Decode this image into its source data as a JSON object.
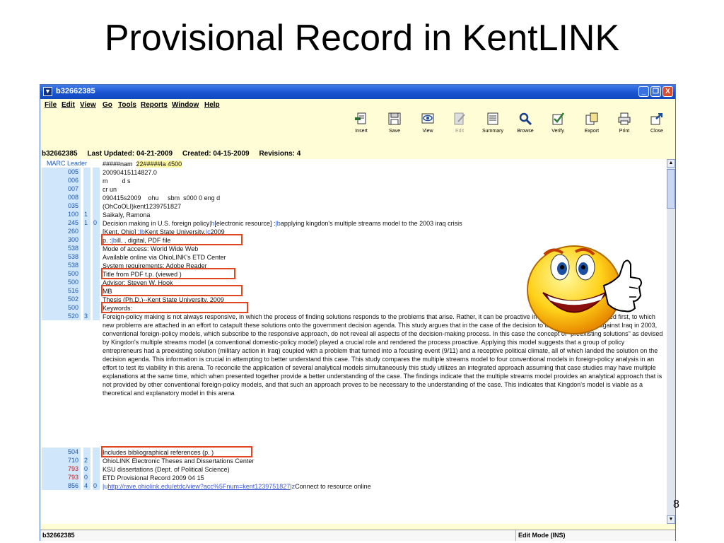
{
  "slide": {
    "title": "Provisional Record in KentLINK",
    "page_number": "8"
  },
  "window": {
    "title": "b32662385",
    "buttons": {
      "minimize": "_",
      "restore": "❐",
      "close": "X"
    }
  },
  "menu": [
    "File",
    "Edit",
    "View",
    "Go",
    "Tools",
    "Reports",
    "Window",
    "Help"
  ],
  "toolbar": {
    "insert": "Insert",
    "save": "Save",
    "view": "View",
    "edit": "Edit",
    "summary": "Summary",
    "browse": "Browse",
    "verify": "Verify",
    "export": "Export",
    "print": "Print",
    "close": "Close"
  },
  "info": {
    "record_id": "b32662385",
    "last_updated": "Last Updated: 04-21-2009",
    "created": "Created: 04-15-2009",
    "revisions": "Revisions: 4"
  },
  "records": {
    "leader": {
      "label": "MARC Leader",
      "a": "#####nam  ",
      "b": "22#####la",
      "c": " 4500"
    },
    "r005": {
      "tag": "005",
      "i1": "",
      "i2": "",
      "text": "20090415114827.0"
    },
    "r006": {
      "tag": "006",
      "i1": "",
      "i2": "",
      "text": "m        d s"
    },
    "r007": {
      "tag": "007",
      "i1": "",
      "i2": "",
      "text": "cr un"
    },
    "r008": {
      "tag": "008",
      "i1": "",
      "i2": "",
      "text": "090415s2009    ohu     sbm  s000 0 eng d"
    },
    "r035": {
      "tag": "035",
      "i1": "",
      "i2": "",
      "text": "(OhCoOLI)kent1239751827"
    },
    "r100": {
      "tag": "100",
      "i1": "1",
      "i2": "",
      "text": "Saikaly, Ramona"
    },
    "r245": {
      "tag": "245",
      "i1": "1",
      "i2": "0",
      "a": "Decision making in U.S. foreign policy",
      "sf_h": "|h",
      "b": "[electronic resource] :",
      "sf_b": "|b",
      "c": "applying kingdon's multiple streams model to the 2003 iraq crisis"
    },
    "r260": {
      "tag": "260",
      "i1": "",
      "i2": "",
      "a": "[Kent, Ohio] :",
      "sf_b": "|b",
      "b": "Kent State University,",
      "sf_c": "|c",
      "c": "2009"
    },
    "r300": {
      "tag": "300",
      "i1": "",
      "i2": "",
      "a": "p. :",
      "sf_b": "|b",
      "b": "ill. , digital, PDF file"
    },
    "r538a": {
      "tag": "538",
      "i1": "",
      "i2": "",
      "text": "Mode of access: World Wide Web"
    },
    "r538b": {
      "tag": "538",
      "i1": "",
      "i2": "",
      "text": "Available online via OhioLINK's ETD Center"
    },
    "r538c": {
      "tag": "538",
      "i1": "",
      "i2": "",
      "text": "System requirements: Adobe Reader"
    },
    "r500a": {
      "tag": "500",
      "i1": "",
      "i2": "",
      "text": "Title from PDF t.p. (viewed  )"
    },
    "r500b": {
      "tag": "500",
      "i1": "",
      "i2": "",
      "text": "Advisor: Steven W. Hook"
    },
    "r516": {
      "tag": "516",
      "i1": "",
      "i2": "",
      "text": "MB"
    },
    "r502": {
      "tag": "502",
      "i1": "",
      "i2": "",
      "text": "Thesis (Ph.D.)--Kent State University, 2009"
    },
    "r500c": {
      "tag": "500",
      "i1": "",
      "i2": "",
      "text": "Keywords:"
    },
    "r520": {
      "tag": "520",
      "i1": "3",
      "i2": "",
      "text": "Foreign-policy making is not always responsive, in which the process of finding solutions responds to the problems that arise. Rather, it can be proactive in which solutions are devised first, to which new problems are attached in an effort to catapult these solutions onto the government decision agenda. This study argues that in the case of the decision to take military action against Iraq in 2003, conventional foreign-policy models, which subscribe to the responsive approach, do not reveal all aspects of the decision-making process. In this case the concept of \"preexisting solutions\" as devised by Kingdon's multiple streams model (a conventional domestic-policy model) played a crucial role and rendered the process proactive. Applying this model suggests that a group of policy entrepreneurs had a preexisting solution (military action in Iraq) coupled with a problem that turned into a focusing event (9/11) and a receptive political climate, all of which landed the solution on the decision agenda. This information is crucial in attempting to better understand this case.  This study compares the multiple streams model to four conventional models in foreign-policy analysis in an effort to test its viability in this arena. To reconcile the application of several analytical models simultaneously this study utilizes an integrated approach assuming that case studies may have multiple explanations at the same time, which when presented together provide a better understanding of the case. The findings indicate that the multiple streams model provides an analytical approach that is not provided by other conventional foreign-policy models, and that such an approach proves to be necessary to the understanding of the case. This indicates that Kingdon's model is viable as a theoretical and explanatory model in this arena"
    },
    "r504": {
      "tag": "504",
      "i1": "",
      "i2": "",
      "text": "Includes bibliographical references (p.  )"
    },
    "r710": {
      "tag": "710",
      "i1": "2",
      "i2": "",
      "text": "OhioLINK Electronic Theses and Dissertations Center"
    },
    "r793a": {
      "tag": "793",
      "i1": "0",
      "i2": "",
      "text": "KSU dissertations (Dept. of Political Science)"
    },
    "r793b": {
      "tag": "793",
      "i1": "0",
      "i2": "",
      "text": "ETD Provisional Record 2009 04 15"
    },
    "r856": {
      "tag": "856",
      "i1": "4",
      "i2": "0",
      "sf_u": "|u",
      "url": "http://rave.ohiolink.edu/etdc/view?acc%5Fnum=kent1239751827",
      "sf_z": "|z",
      "z": "Connect to resource online"
    }
  },
  "status": {
    "record_id": "b32662385",
    "mode": "Edit Mode (INS)"
  },
  "colors": {
    "titlebar": "#1a55d0",
    "panel_bg": "#fffdd6",
    "tag_blue": "#1d5ab0",
    "tag_red": "#cc1a1a",
    "highlight_box": "#e0461f"
  },
  "icons": [
    "insert-icon",
    "save-icon",
    "view-icon",
    "edit-icon",
    "summary-icon",
    "browse-icon",
    "verify-icon",
    "export-icon",
    "print-icon",
    "close-icon",
    "smiley-thumbs-up-icon"
  ]
}
